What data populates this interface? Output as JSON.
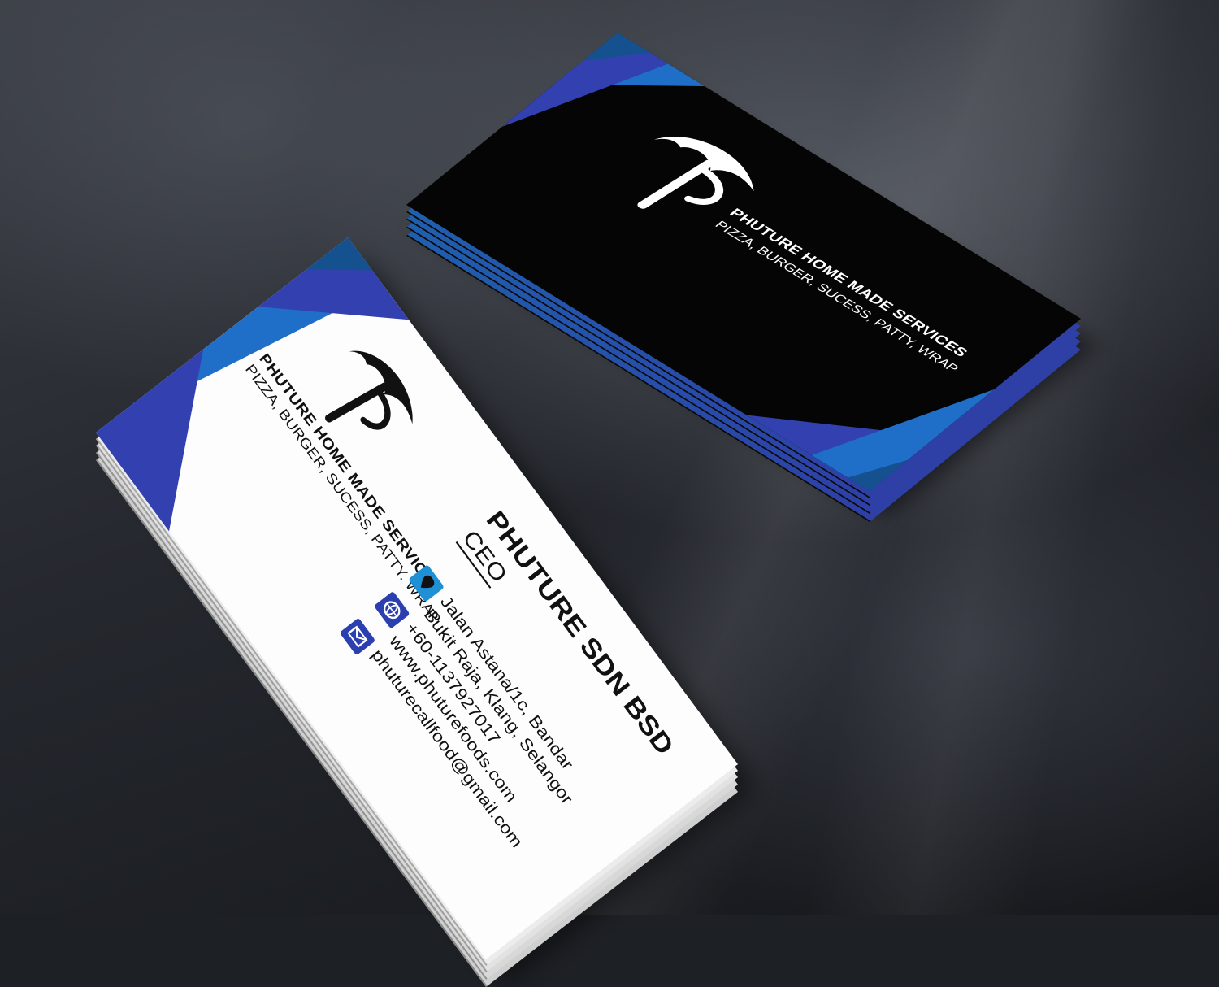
{
  "back_card": {
    "logo_letter": "P",
    "tagline_line1": "PHUTURE HOME MADE SERVICES",
    "tagline_line2": "PIZZA, BURGER, SUCESS, PATTY, WRAP",
    "colors": {
      "background": "#050505",
      "accent_blue": "#1f6fc9",
      "accent_indigo": "#3340b0",
      "logo": "#ffffff"
    }
  },
  "front_card": {
    "logo_letter": "P",
    "tagline_line1": "PHUTURE HOME MADE SERVICES",
    "tagline_line2": "PIZZA, BURGER, SUCESS, PATTY, WRAP",
    "name": "PHUTURE SDN BSD",
    "title": "CEO",
    "contacts": [
      {
        "icon": "location-pin-icon",
        "lines": [
          "Jalan Astana/1c, Bandar",
          "Bukit Raja, Klang, Selangor"
        ]
      },
      {
        "icon": "globe-icon",
        "lines": [
          "+60-1137927017",
          "www.phuturefoods.com"
        ]
      },
      {
        "icon": "mail-icon",
        "lines": [
          "phuturecallfood@gmail.com"
        ]
      }
    ],
    "colors": {
      "background": "#fdfdfd",
      "accent_blue": "#1f6fc9",
      "accent_indigo": "#3340b0",
      "text": "#111111"
    }
  }
}
